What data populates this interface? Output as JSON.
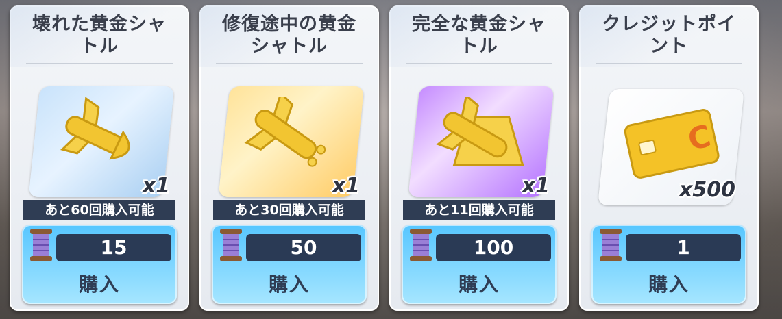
{
  "shop": {
    "items": [
      {
        "title_line1": "壊れた黄金シャ",
        "title_line2": "トル",
        "quantity": "x1",
        "limit": "あと60回購入可能",
        "price": "15",
        "buy_label": "購入",
        "icon": "golden-shuttle-broken-icon"
      },
      {
        "title_line1": "修復途中の黄金",
        "title_line2": "シャトル",
        "quantity": "x1",
        "limit": "あと30回購入可能",
        "price": "50",
        "buy_label": "購入",
        "icon": "golden-shuttle-repairing-icon"
      },
      {
        "title_line1": "完全な黄金シャ",
        "title_line2": "トル",
        "quantity": "x1",
        "limit": "あと11回購入可能",
        "price": "100",
        "buy_label": "購入",
        "icon": "golden-shuttle-complete-icon"
      },
      {
        "title_line1": "クレジットポイ",
        "title_line2": "ント",
        "quantity": "x500",
        "limit": "",
        "price": "1",
        "buy_label": "購入",
        "icon": "credit-card-icon"
      }
    ],
    "currency_icon": "thread-spool-icon",
    "colors": {
      "limit_bar": "#2f3d54",
      "price_bar": "#2a3a55",
      "button": "#7fd6ff",
      "title": "#3a3f4c"
    }
  }
}
